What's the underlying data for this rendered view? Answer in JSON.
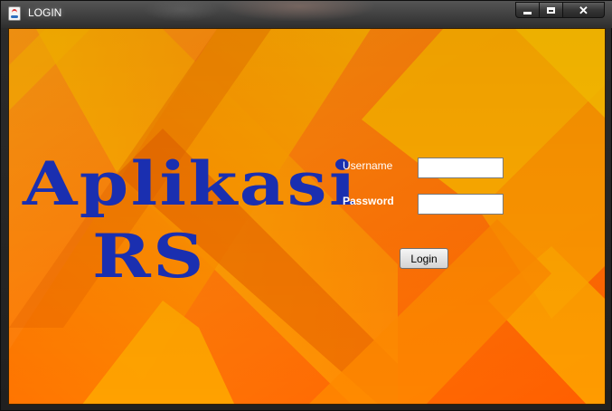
{
  "window": {
    "title": "LOGIN",
    "icon": "java-app-icon",
    "controls": {
      "minimize": "minimize-icon",
      "maximize": "maximize-icon",
      "close": "close-icon"
    }
  },
  "brand": {
    "line1": "Aplikasi",
    "line2": "RS",
    "color": "#1a2fb0"
  },
  "form": {
    "username_label": "Username",
    "password_label": "Password",
    "username_value": "",
    "password_value": "",
    "login_label": "Login"
  },
  "theme": {
    "background_base": "#ff7c0a",
    "background_accent": "#ffb300"
  }
}
